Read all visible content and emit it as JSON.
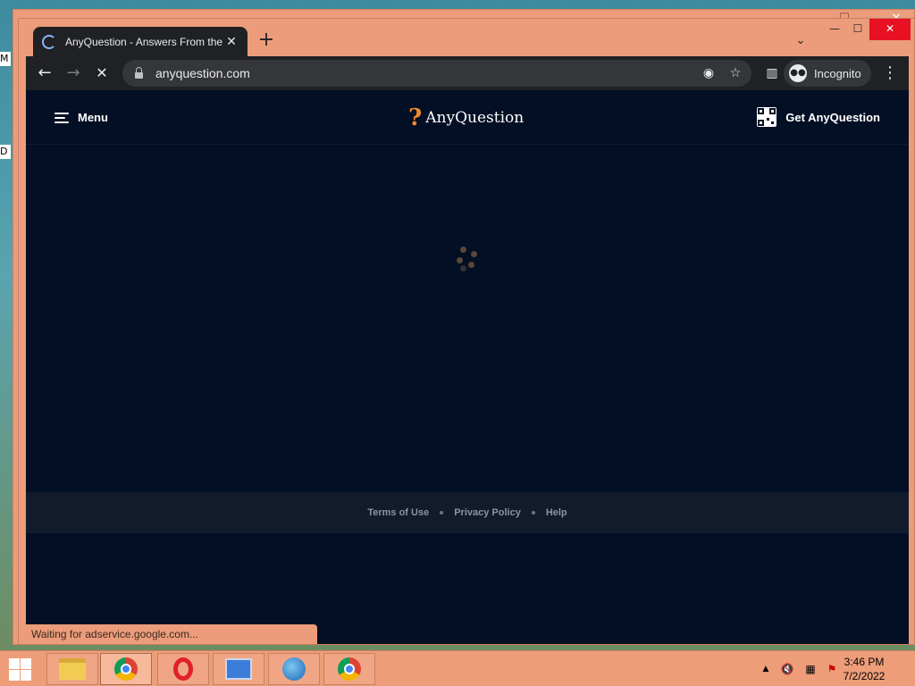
{
  "desktop": {
    "label_top": "M",
    "label_mid": "D"
  },
  "browser": {
    "tab": {
      "title": "AnyQuestion - Answers From the",
      "close_glyph": "✕"
    },
    "new_tab_glyph": "+",
    "tab_search_glyph": "⌄",
    "window_controls": {
      "minimize": "—",
      "maximize": "☐",
      "close": "✕"
    },
    "toolbar": {
      "back_glyph": "←",
      "forward_glyph": "→",
      "stop_glyph": "✕",
      "url": "anyquestion.com",
      "incognito_label": "Incognito",
      "menu_glyph": "⋮"
    },
    "status_text": "Waiting for adservice.google.com..."
  },
  "site": {
    "menu_label": "Menu",
    "logo_mark": "?",
    "logo_text": "AnyQuestion",
    "get_app_label": "Get AnyQuestion",
    "footer_links": [
      "Terms of Use",
      "Privacy Policy",
      "Help"
    ],
    "accent_color": "#f2892e",
    "background_color": "#020f24"
  },
  "taskbar": {
    "apps": [
      "file-explorer",
      "chrome",
      "opera",
      "control-panel",
      "clock-globe",
      "chrome"
    ],
    "tray": {
      "show_hidden_glyph": "▲"
    },
    "time": "3:46 PM",
    "date": "7/2/2022"
  }
}
